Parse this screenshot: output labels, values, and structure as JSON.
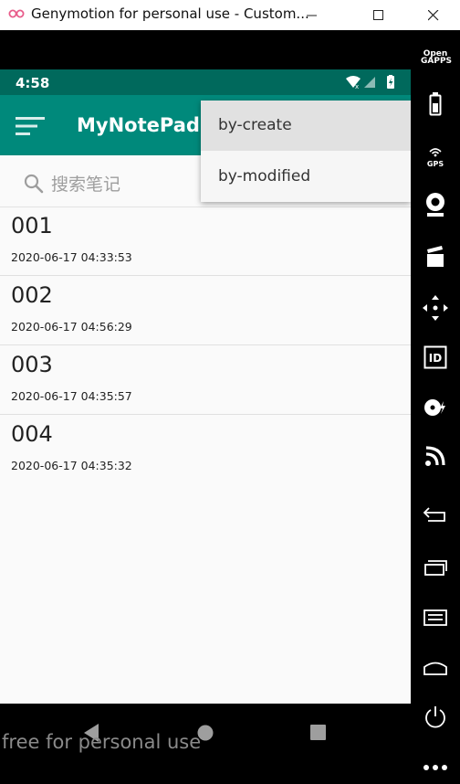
{
  "window": {
    "title": "Genymotion for personal use - Custom..."
  },
  "status_bar": {
    "time": "4:58"
  },
  "toolbar": {
    "title": "MyNotePad"
  },
  "search": {
    "placeholder": "搜索笔记"
  },
  "menu": {
    "items": [
      {
        "label": "by-create"
      },
      {
        "label": "by-modified"
      }
    ]
  },
  "notes": [
    {
      "title": "001",
      "date": "2020-06-17 04:33:53"
    },
    {
      "title": "002",
      "date": "2020-06-17 04:56:29"
    },
    {
      "title": "003",
      "date": "2020-06-17 04:35:57"
    },
    {
      "title": "004",
      "date": "2020-06-17 04:35:32"
    }
  ],
  "watermark": "free for personal use",
  "sidebar": {
    "opengapps_label": "Open GAPPS",
    "gps_label": "GPS",
    "id_label": "ID"
  },
  "colors": {
    "status_bar": "#00695c",
    "toolbar": "#00897b",
    "content_bg": "#fafafa"
  }
}
